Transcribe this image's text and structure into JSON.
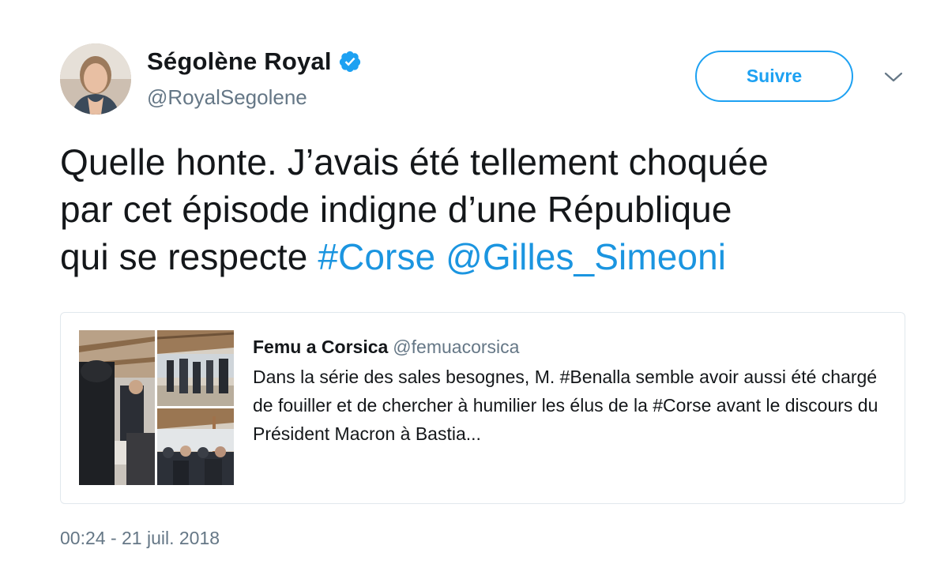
{
  "author": {
    "name": "Ségolène Royal",
    "handle": "@RoyalSegolene",
    "verified_icon": "verified-badge-icon"
  },
  "actions": {
    "follow_label": "Suivre",
    "more_icon": "chevron-down-icon"
  },
  "tweet": {
    "line1": "Quelle honte. J’avais été tellement choquée",
    "line2": "par cet épisode indigne d’une République",
    "line3_text": "qui se respecte ",
    "hashtag": "#Corse",
    "mention": "@Gilles_Simeoni"
  },
  "quoted_tweet": {
    "name": "Femu a Corsica",
    "handle": "@femuacorsica",
    "text": "Dans la série des sales besognes, M. #Benalla semble avoir aussi été chargé de fouiller et de chercher à humilier les élus de la #Corse avant le discours du Président Macron à Bastia..."
  },
  "timestamp": "00:24 - 21 juil. 2018",
  "colors": {
    "accent": "#1da1f2",
    "link": "#1b95e0",
    "secondary_text": "#657786",
    "border": "#e1e8ed"
  }
}
